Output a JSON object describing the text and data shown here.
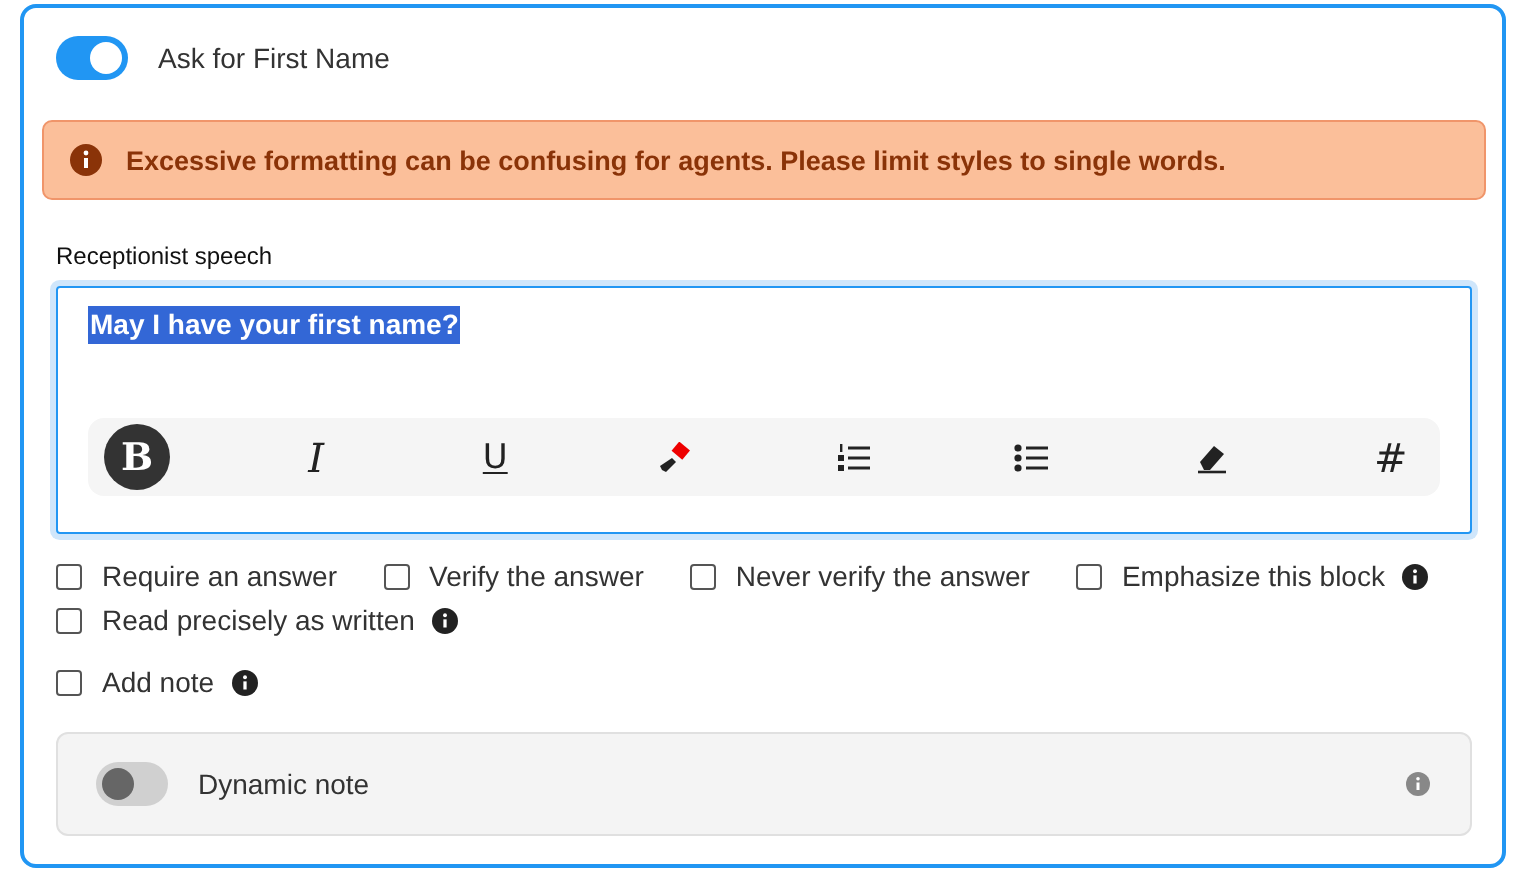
{
  "header": {
    "toggle_on": true,
    "label": "Ask for First Name"
  },
  "alert": {
    "text": "Excessive formatting can be confusing for agents. Please limit styles to single words."
  },
  "editor": {
    "label": "Receptionist speech",
    "value": "May I have your first name?",
    "text_selected": true,
    "tools": [
      {
        "kind": "bold",
        "label": "B",
        "selected": true
      },
      {
        "kind": "italic",
        "label": "I",
        "selected": false
      },
      {
        "kind": "underline",
        "label": "U",
        "selected": false
      },
      {
        "kind": "highlight",
        "selected": false
      },
      {
        "kind": "ordered-list",
        "selected": false
      },
      {
        "kind": "bullet-list",
        "selected": false
      },
      {
        "kind": "eraser",
        "selected": false
      },
      {
        "kind": "hash",
        "label": "#",
        "selected": false
      }
    ]
  },
  "options": [
    {
      "label": "Require an answer",
      "checked": false,
      "info": false
    },
    {
      "label": "Verify the answer",
      "checked": false,
      "info": false
    },
    {
      "label": "Never verify the answer",
      "checked": false,
      "info": false
    },
    {
      "label": "Emphasize this block",
      "checked": false,
      "info": true
    },
    {
      "label": "Read precisely as written",
      "checked": false,
      "info": true
    }
  ],
  "add_note": {
    "label": "Add note",
    "checked": false,
    "info": true
  },
  "dynamic_note": {
    "toggle_on": false,
    "label": "Dynamic note"
  }
}
